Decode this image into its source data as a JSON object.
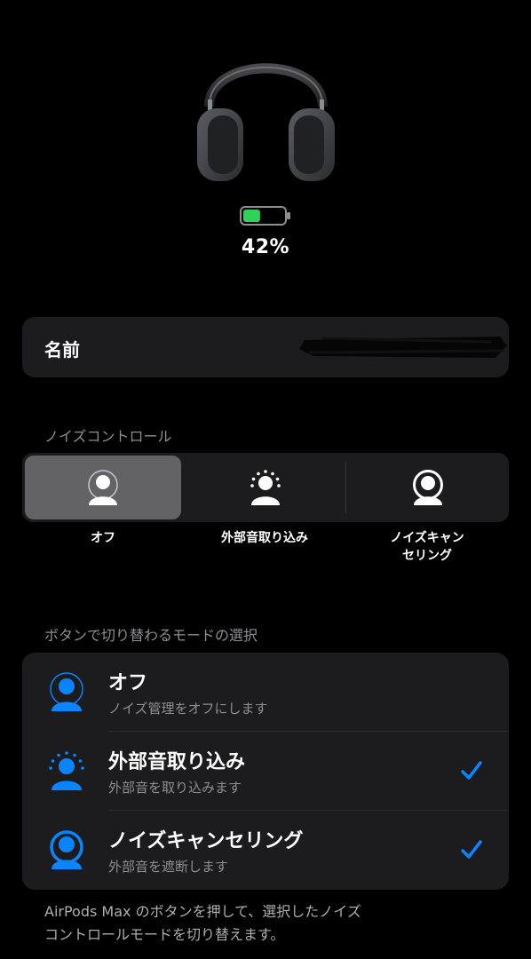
{
  "device": {
    "battery_percent_label": "42%",
    "battery_level": 0.42,
    "battery_color": "#30d158"
  },
  "name_row": {
    "label": "名前"
  },
  "noise_control": {
    "header": "ノイズコントロール",
    "selected_index": 0,
    "options": [
      {
        "label": "オフ",
        "icon": "person-off-icon"
      },
      {
        "label": "外部音取り込み",
        "icon": "person-transparency-icon"
      },
      {
        "label_line1": "ノイズキャン",
        "label_line2": "セリング",
        "icon": "person-noise-cancel-icon"
      }
    ]
  },
  "button_modes": {
    "header": "ボタンで切り替わるモードの選択",
    "accent_color": "#0a84ff",
    "items": [
      {
        "title": "オフ",
        "subtitle": "ノイズ管理をオフにします",
        "checked": false,
        "icon": "person-off-icon"
      },
      {
        "title": "外部音取り込み",
        "subtitle": "外部音を取り込みます",
        "checked": true,
        "icon": "person-transparency-icon"
      },
      {
        "title": "ノイズキャンセリング",
        "subtitle": "外部音を遮断します",
        "checked": true,
        "icon": "person-noise-cancel-icon"
      }
    ]
  },
  "footer": {
    "line1": "AirPods Max のボタンを押して、選択したノイズ",
    "line2": "コントロールモードを切り替えます。"
  }
}
